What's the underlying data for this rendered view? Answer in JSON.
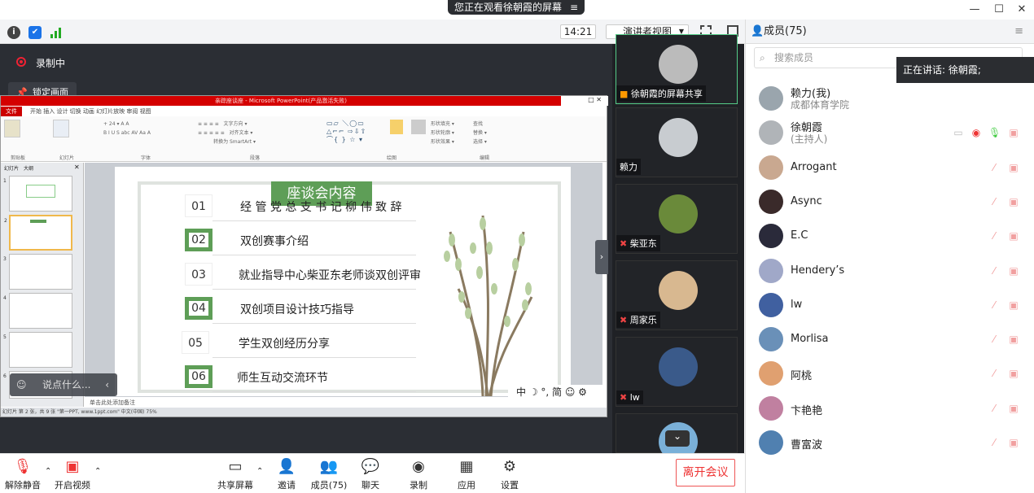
{
  "window": {
    "share_banner": "您正在观看徐朝霞的屏幕",
    "menu_icon": "≡",
    "minimize": "—",
    "maximize": "☐",
    "close": "✕"
  },
  "toolbar": {
    "time": "14:21",
    "view_mode": "演讲者视图",
    "info_icon": "i",
    "shield_icon": "✔",
    "signal_icon": "signal"
  },
  "stage": {
    "recording": "录制中",
    "lock_screen": "锁定画面",
    "chat_placeholder": "说点什么...",
    "ime": "中 ☽ °, 简 ☺ ⚙"
  },
  "ppt": {
    "window_title": "亲踪座谈座 - Microsoft PowerPoint(产品激活失败)",
    "file_tab": "文件",
    "tabs": "开始   插入   设计   切换   动画   幻灯片放映   审阅   视图",
    "groups": [
      "剪贴板",
      "幻灯片",
      "字体",
      "段落",
      "绘图",
      "编辑"
    ],
    "ribbon_items": [
      "粘贴",
      "新建幻灯片",
      "版式",
      "重置",
      "节",
      "文字方向",
      "对齐文本",
      "转换为 SmartArt",
      "排列",
      "快速样式",
      "形状填充",
      "形状轮廓",
      "形状效果",
      "查找",
      "替换",
      "选择"
    ],
    "thumb_tabs": [
      "幻灯片",
      "大纲"
    ],
    "thumb_numbers": [
      "1",
      "2",
      "3",
      "4",
      "5",
      "6"
    ],
    "notes": "单击此处添加备注",
    "status": "幻灯片 第 2 张，共 9 张    \"第一PPT, www.1ppt.com\"    中文(中国)                                                                     75%"
  },
  "slide": {
    "title": "座谈会内容",
    "items": [
      {
        "num": "01",
        "text": "经 管 党 总 支 书 记 柳 伟 致 辞",
        "green": false
      },
      {
        "num": "02",
        "text": "双创赛事介绍",
        "green": true
      },
      {
        "num": "03",
        "text": "就业指导中心柴亚东老师谈双创评审",
        "green": false
      },
      {
        "num": "04",
        "text": "双创项目设计技巧指导",
        "green": true
      },
      {
        "num": "05",
        "text": "学生双创经历分享",
        "green": false
      },
      {
        "num": "06",
        "text": "师生互动交流环节",
        "green": true
      }
    ]
  },
  "videos": [
    {
      "name": "徐朝霞的屏幕共享",
      "muted": false
    },
    {
      "name": "赖力",
      "muted": false
    },
    {
      "name": "柴亚东",
      "muted": true
    },
    {
      "name": "周家乐",
      "muted": true
    },
    {
      "name": "lw",
      "muted": true
    },
    {
      "name": "",
      "muted": false
    }
  ],
  "members": {
    "header": "成员(75)",
    "search_placeholder": "搜索成员",
    "speaking": "正在讲话: 徐朝霞;",
    "list": [
      {
        "name": "赖力(我)",
        "sub": "成都体育学院"
      },
      {
        "name": "徐朝霞",
        "sub": "(主持人)"
      },
      {
        "name": "Arrogant",
        "sub": ""
      },
      {
        "name": "Async",
        "sub": ""
      },
      {
        "name": "E.C",
        "sub": ""
      },
      {
        "name": "Hendery’s",
        "sub": ""
      },
      {
        "name": "lw",
        "sub": ""
      },
      {
        "name": "Morlisa",
        "sub": ""
      },
      {
        "name": "阿桃",
        "sub": ""
      },
      {
        "name": "卞艳艳",
        "sub": ""
      },
      {
        "name": "曹富波",
        "sub": ""
      }
    ]
  },
  "bottom": {
    "unmute": "解除静音",
    "start_video": "开启视频",
    "share": "共享屏幕",
    "invite": "邀请",
    "members": "成员(75)",
    "chat": "聊天",
    "record": "录制",
    "apps": "应用",
    "settings": "设置",
    "leave": "离开会议"
  },
  "colors": {
    "accent_red": "#e33333",
    "slide_green": "#5e9e57",
    "dark_bg": "#2b2e34"
  }
}
